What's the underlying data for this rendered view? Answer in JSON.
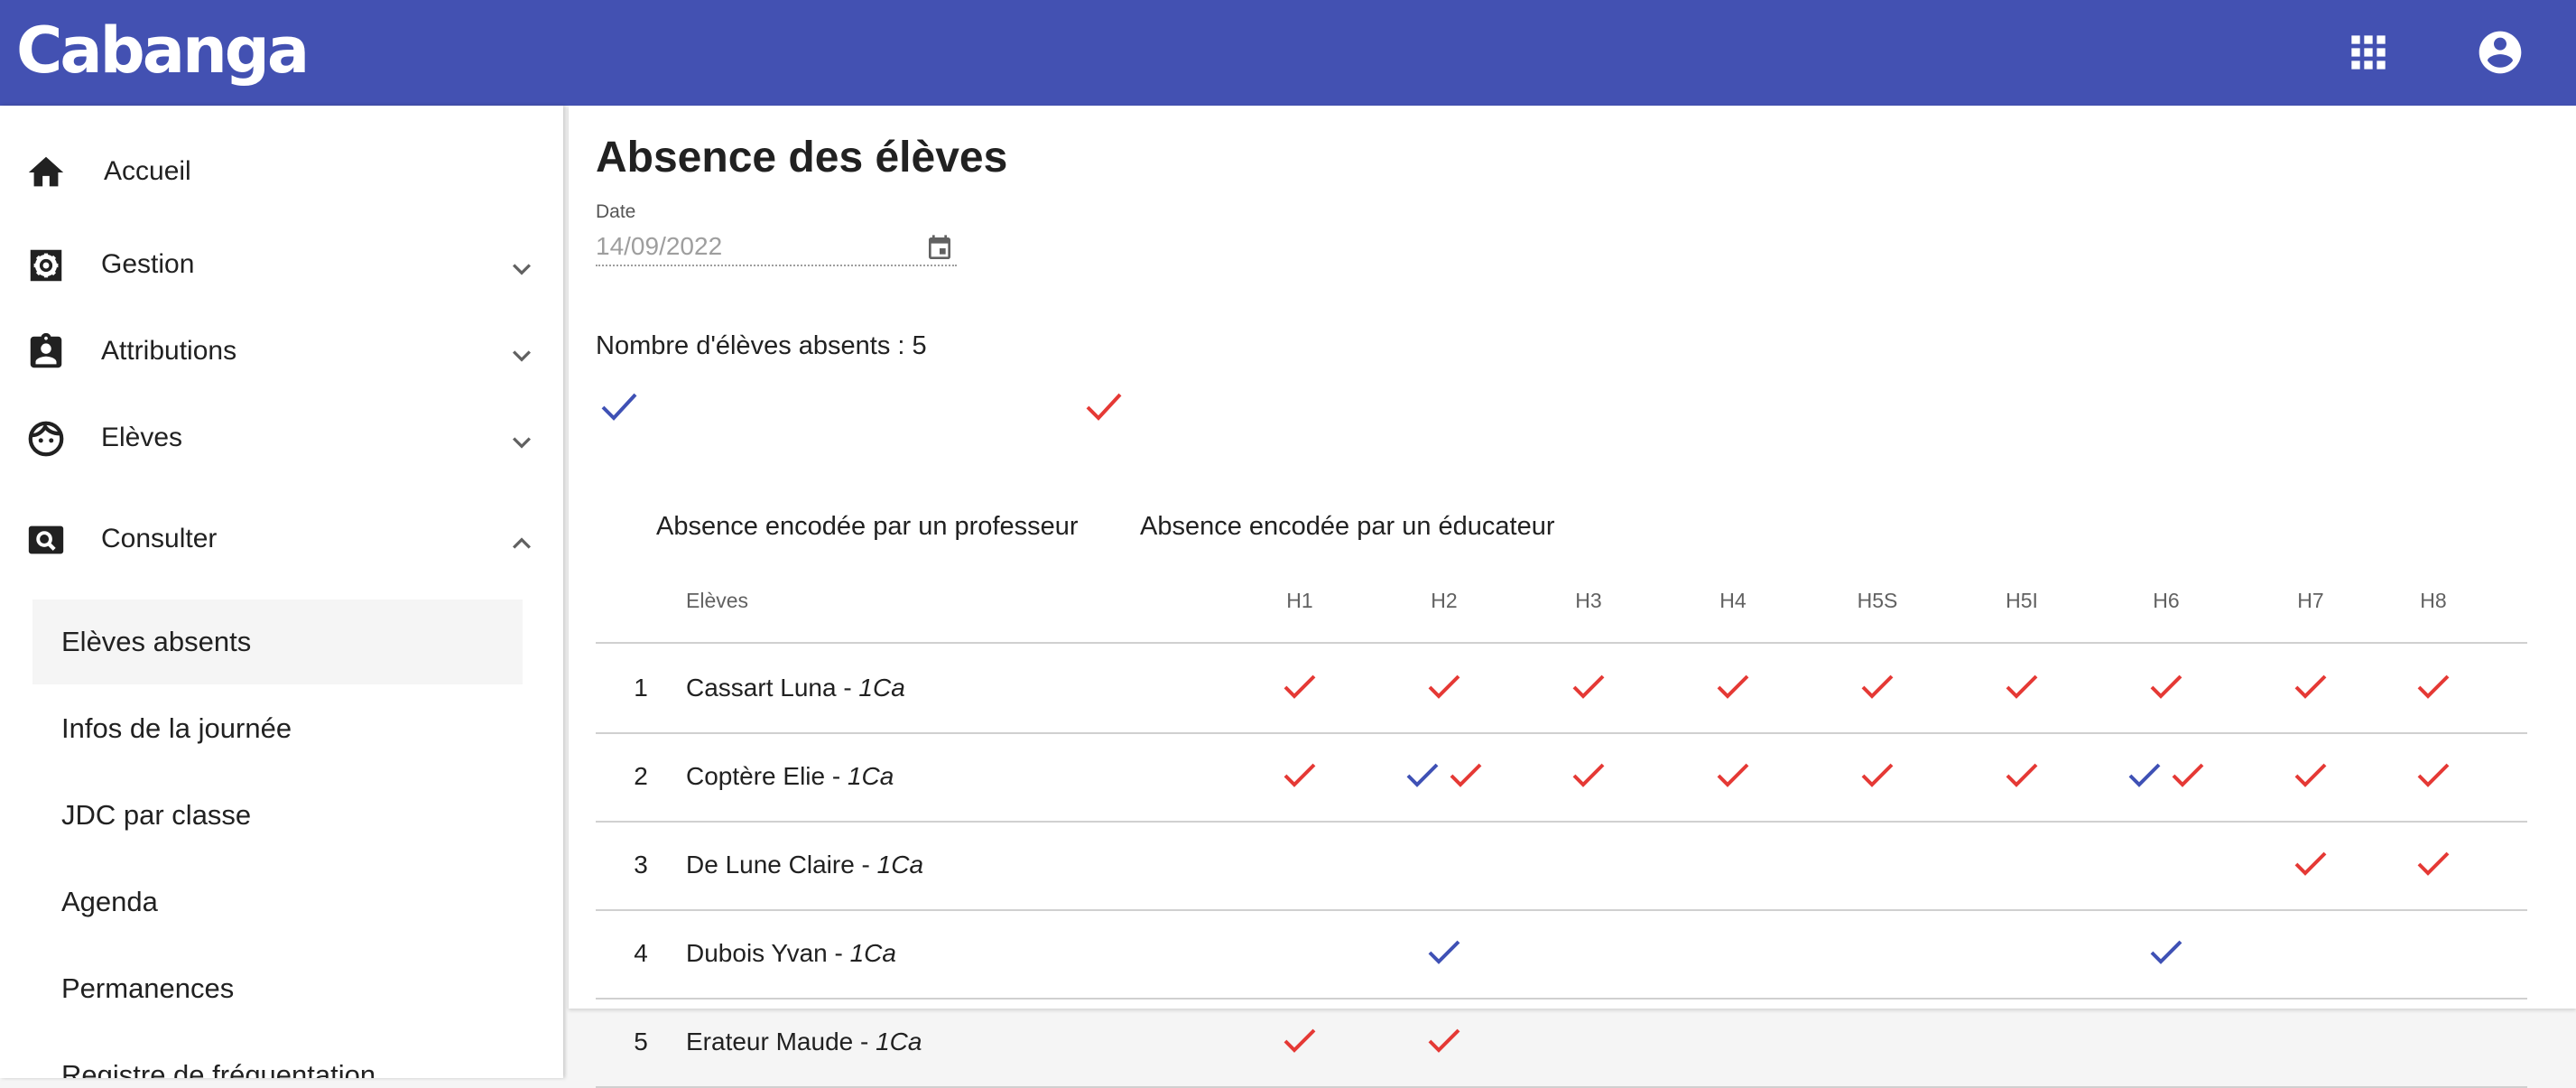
{
  "app": {
    "logo": "Cabanga",
    "icons": [
      "apps-icon",
      "account-icon"
    ]
  },
  "colors": {
    "primary": "#4351b2",
    "teacher_check": "#3f51b5",
    "educator_check": "#e53935"
  },
  "sidebar": {
    "items": [
      {
        "label": "Accueil",
        "icon": "home-icon"
      },
      {
        "label": "Gestion",
        "icon": "settings-icon",
        "expanded": false
      },
      {
        "label": "Attributions",
        "icon": "clipboard-user-icon",
        "expanded": false
      },
      {
        "label": "Elèves",
        "icon": "face-icon",
        "expanded": false
      },
      {
        "label": "Consulter",
        "icon": "search-box-icon",
        "expanded": true
      }
    ],
    "sub_items": [
      {
        "label": "Elèves absents",
        "active": true
      },
      {
        "label": "Infos de la journée"
      },
      {
        "label": "JDC par classe"
      },
      {
        "label": "Agenda"
      },
      {
        "label": "Permanences"
      },
      {
        "label": "Registre de fréquentation"
      }
    ]
  },
  "main": {
    "title": "Absence des élèves",
    "date_label": "Date",
    "date_value": "14/09/2022",
    "count_text": "Nombre d'élèves absents : 5",
    "legend": {
      "teacher": "Absence encodée par un professeur",
      "educator": "Absence encodée par un éducateur"
    },
    "table": {
      "name_header": "Elèves",
      "periods": [
        "H1",
        "H2",
        "H3",
        "H4",
        "H5S",
        "H5I",
        "H6",
        "H7",
        "H8"
      ],
      "rows": [
        {
          "index": "1",
          "name": "Cassart Luna - ",
          "class": "1Ca",
          "marks": {
            "H1": [
              "educator"
            ],
            "H2": [
              "educator"
            ],
            "H3": [
              "educator"
            ],
            "H4": [
              "educator"
            ],
            "H5S": [
              "educator"
            ],
            "H5I": [
              "educator"
            ],
            "H6": [
              "educator"
            ],
            "H7": [
              "educator"
            ],
            "H8": [
              "educator"
            ]
          }
        },
        {
          "index": "2",
          "name": "Coptère Elie - ",
          "class": "1Ca",
          "marks": {
            "H1": [
              "educator"
            ],
            "H2": [
              "teacher",
              "educator"
            ],
            "H3": [
              "educator"
            ],
            "H4": [
              "educator"
            ],
            "H5S": [
              "educator"
            ],
            "H5I": [
              "educator"
            ],
            "H6": [
              "teacher",
              "educator"
            ],
            "H7": [
              "educator"
            ],
            "H8": [
              "educator"
            ]
          }
        },
        {
          "index": "3",
          "name": "De Lune Claire - ",
          "class": "1Ca",
          "marks": {
            "H7": [
              "educator"
            ],
            "H8": [
              "educator"
            ]
          }
        },
        {
          "index": "4",
          "name": "Dubois Yvan - ",
          "class": "1Ca",
          "marks": {
            "H2": [
              "teacher"
            ],
            "H6": [
              "teacher"
            ]
          }
        },
        {
          "index": "5",
          "name": "Erateur Maude - ",
          "class": "1Ca",
          "marks": {
            "H1": [
              "educator"
            ],
            "H2": [
              "educator"
            ]
          }
        }
      ]
    }
  }
}
